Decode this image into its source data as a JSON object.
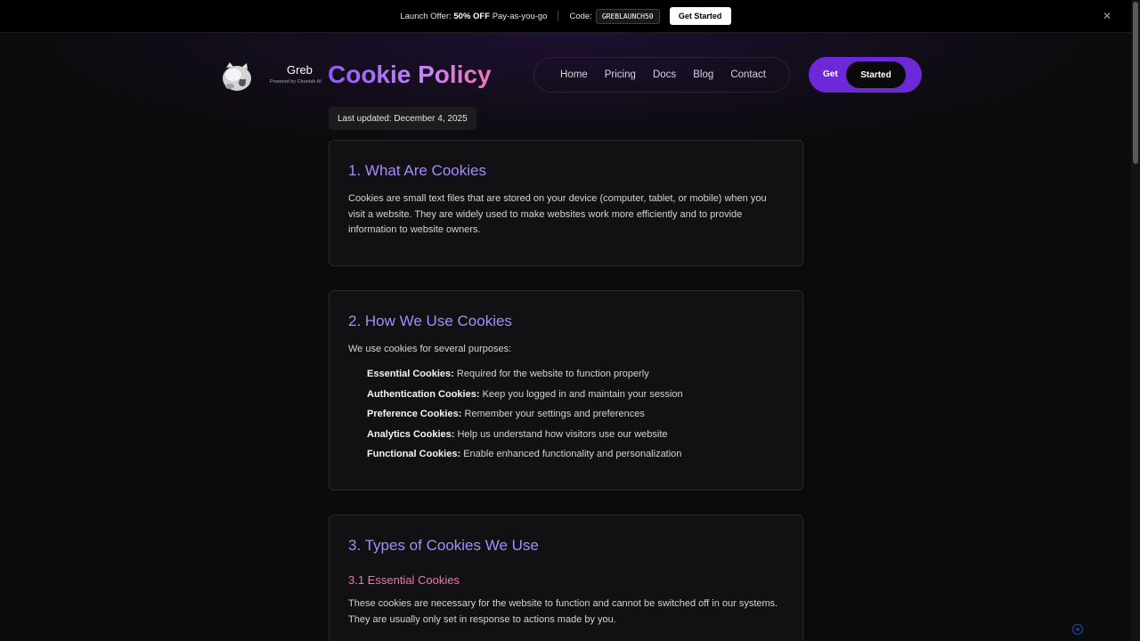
{
  "promo": {
    "prefix": "Launch Offer:",
    "highlight": "50% OFF",
    "suffix": "Pay-as-you-go",
    "code_label": "Code:",
    "code": "GREBLAUNCH50",
    "button": "Get Started",
    "close_icon": "close-icon"
  },
  "header": {
    "brand": "Greb",
    "tagline": "Powered by Cheetah AI",
    "nav": [
      "Home",
      "Pricing",
      "Docs",
      "Blog",
      "Contact"
    ],
    "cta_get": "Get",
    "cta_started": "Started"
  },
  "page": {
    "title": "Cookie Policy",
    "updated": "Last updated: December 4, 2025"
  },
  "sections": {
    "s1": {
      "title": "1. What Are Cookies",
      "body": "Cookies are small text files that are stored on your device (computer, tablet, or mobile) when you visit a website. They are widely used to make websites work more efficiently and to provide information to website owners."
    },
    "s2": {
      "title": "2. How We Use Cookies",
      "intro": "We use cookies for several purposes:",
      "items": [
        {
          "label": "Essential Cookies:",
          "text": "Required for the website to function properly"
        },
        {
          "label": "Authentication Cookies:",
          "text": "Keep you logged in and maintain your session"
        },
        {
          "label": "Preference Cookies:",
          "text": "Remember your settings and preferences"
        },
        {
          "label": "Analytics Cookies:",
          "text": "Help us understand how visitors use our website"
        },
        {
          "label": "Functional Cookies:",
          "text": "Enable enhanced functionality and personalization"
        }
      ]
    },
    "s3": {
      "title": "3. Types of Cookies We Use",
      "sub1": "3.1 Essential Cookies",
      "body": "These cookies are necessary for the website to function and cannot be switched off in our systems. They are usually only set in response to actions made by you."
    }
  },
  "colors": {
    "accent": "#8b5cf6",
    "heading": "#a78bfa",
    "subheading": "#f472b6",
    "cta": "#6d28d9"
  }
}
